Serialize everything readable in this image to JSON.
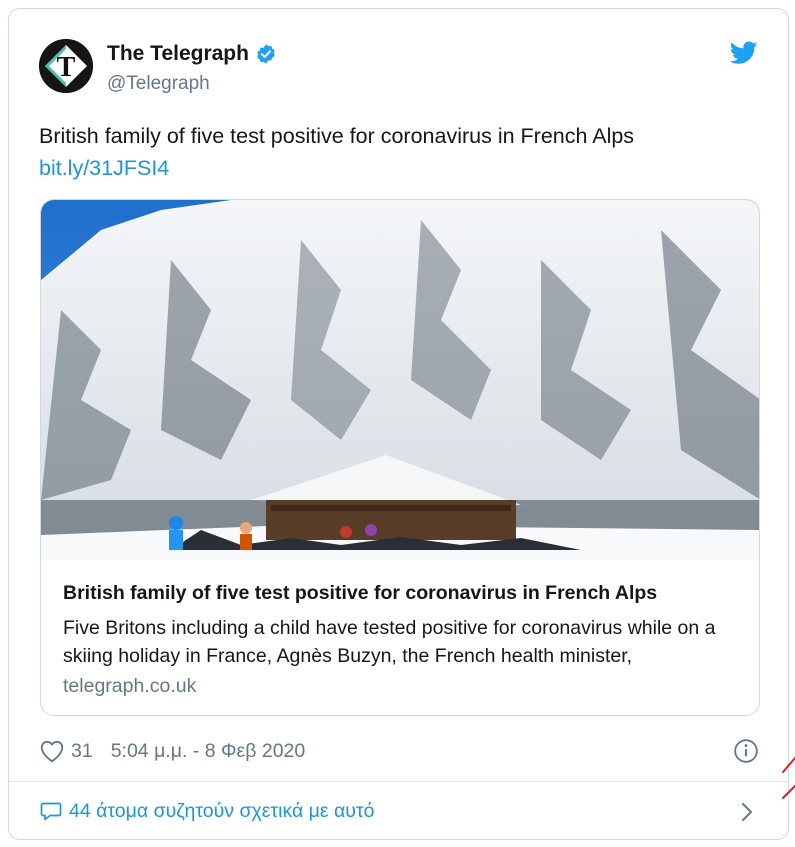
{
  "tweet": {
    "display_name": "The Telegraph",
    "handle": "@Telegraph",
    "text": "British family of five test positive for coronavirus in French Alps",
    "link": "bit.ly/31JFSI4",
    "card": {
      "title": "British family of five test positive for coronavirus in French Alps",
      "description": "Five Britons including a child have tested positive for coronavirus while on a skiing holiday in France, Agnès Buzyn, the French health minister,",
      "domain": "telegraph.co.uk"
    },
    "likes": "31",
    "timestamp": "5:04 μ.μ. - 8 Φεβ 2020",
    "discussion": "44 άτομα συζητούν σχετικά με αυτό"
  },
  "icons": {
    "avatar": "telegraph-logo-icon",
    "verified": "verified-badge-icon",
    "brand": "twitter-bird-icon",
    "like": "heart-icon",
    "info": "info-icon",
    "reply": "speech-bubble-icon",
    "open": "chevron-right-icon"
  },
  "colors": {
    "link": "#1b95e0",
    "secondary_text": "#657786",
    "border": "#cfd9de",
    "verified": "#1da1f2"
  }
}
